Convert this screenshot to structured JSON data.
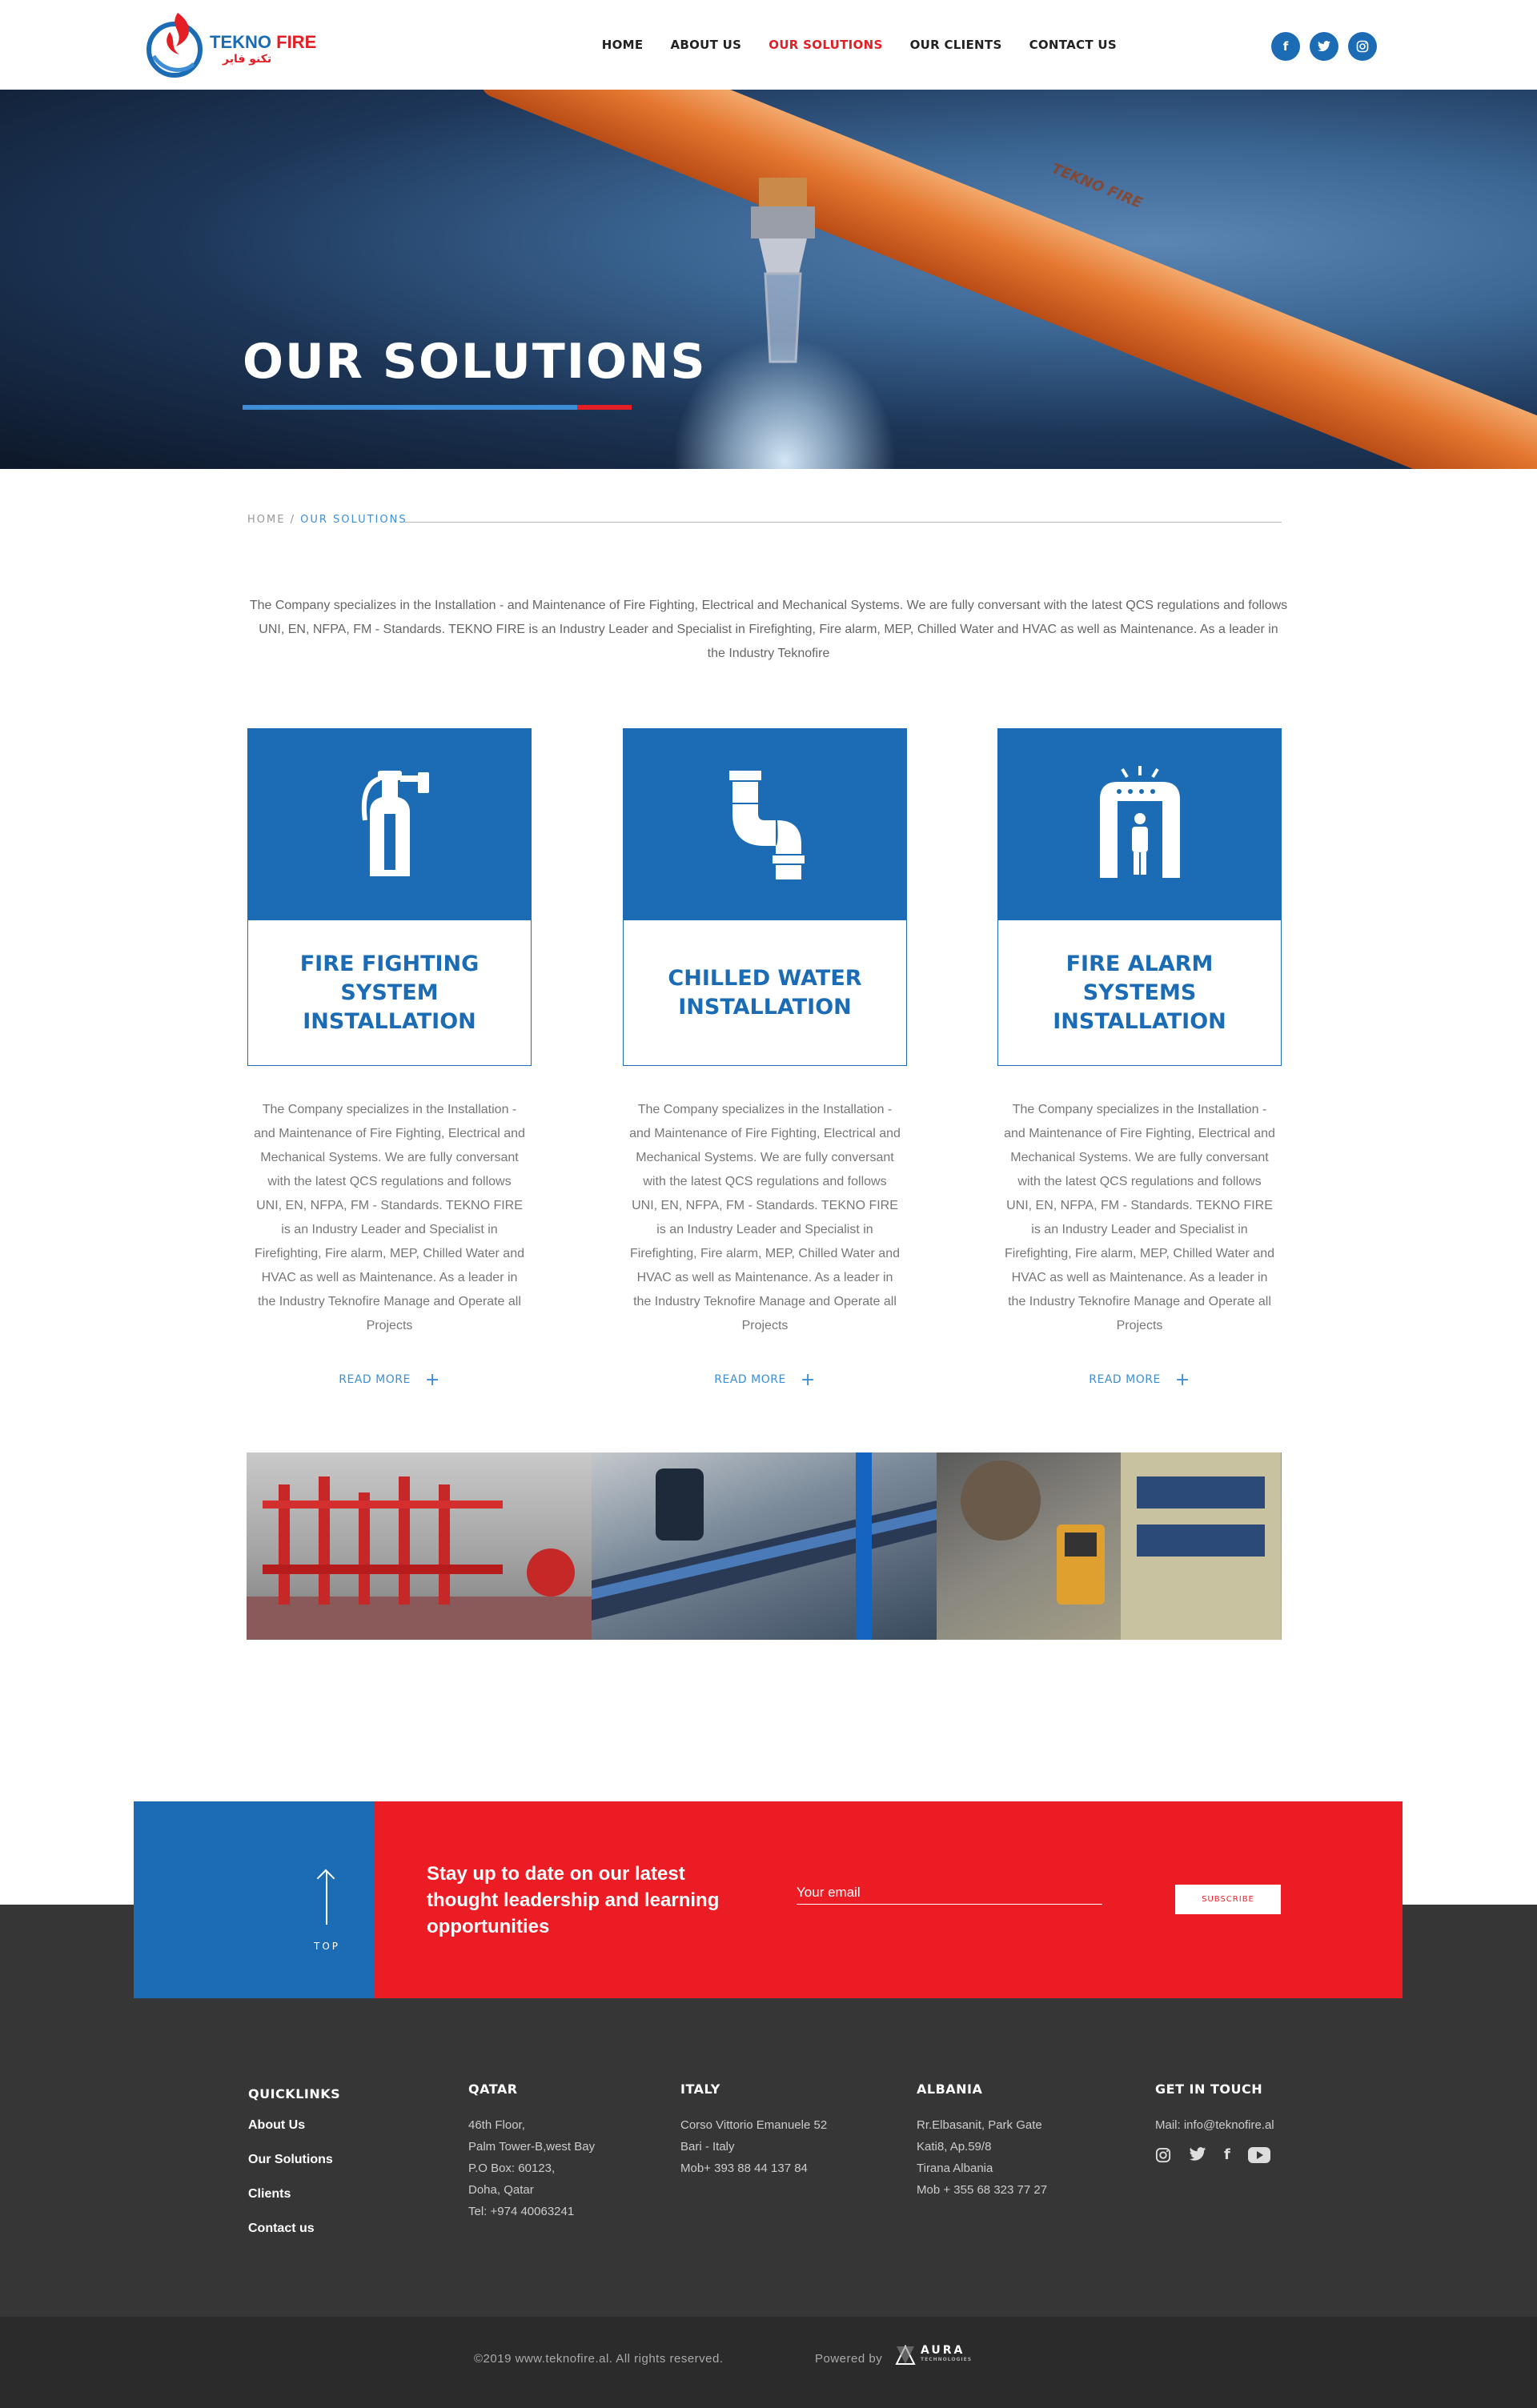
{
  "header": {
    "logo_title_a": "TEKNO",
    "logo_title_b": "FIRE",
    "logo_sub": "تكنو فاير",
    "nav": [
      "HOME",
      "ABOUT US",
      "OUR SOLUTIONS",
      "OUR CLIENTS",
      "CONTACT US"
    ],
    "active_nav": "OUR SOLUTIONS",
    "socials": [
      "facebook-icon",
      "twitter-icon",
      "instagram-icon"
    ]
  },
  "hero": {
    "title": "OUR SOLUTIONS",
    "pipe_brand": "TEKNO FIRE"
  },
  "breadcrumb": {
    "home": "HOME",
    "separator": " / ",
    "current": "OUR SOLUTIONS"
  },
  "intro": "The Company specializes in the Installation - and Maintenance of Fire Fighting, Electrical and Mechanical Systems. We are fully conversant with the latest QCS regulations and follows UNI, EN, NFPA, FM - Standards. TEKNO FIRE is an Industry Leader and Specialist in Firefighting, Fire alarm, MEP, Chilled Water and HVAC as well as Maintenance. As a leader in the Industry Teknofire",
  "cards": [
    {
      "icon": "fire-extinguisher-icon",
      "title": "FIRE FIGHTING SYSTEM INSTALLATION",
      "text": "The Company specializes in the Installation - and Maintenance of Fire Fighting, Electrical and Mechanical Systems. We are fully conversant with the latest QCS regulations and follows UNI, EN, NFPA, FM - Standards. TEKNO FIRE is an Industry Leader and Specialist in Firefighting, Fire alarm, MEP, Chilled Water and HVAC as well as Maintenance. As a leader in the Industry Teknofire Manage and Operate all Projects",
      "read_more": "READ MORE"
    },
    {
      "icon": "pipe-icon",
      "title": "CHILLED WATER INSTALLATION",
      "text": "The Company specializes in the Installation - and Maintenance of Fire Fighting, Electrical and Mechanical Systems. We are fully conversant with the latest QCS regulations and follows UNI, EN, NFPA, FM - Standards. TEKNO FIRE is an Industry Leader and Specialist in Firefighting, Fire alarm, MEP, Chilled Water and HVAC as well as Maintenance. As a leader in the Industry Teknofire Manage and Operate all Projects",
      "read_more": "READ MORE"
    },
    {
      "icon": "alarm-gate-icon",
      "title": "FIRE ALARM SYSTEMS INSTALLATION",
      "text": "The Company specializes in the Installation - and Maintenance of Fire Fighting, Electrical and Mechanical Systems. We are fully conversant with the latest QCS regulations and follows UNI, EN, NFPA, FM - Standards. TEKNO FIRE is an Industry Leader and Specialist in Firefighting, Fire alarm, MEP, Chilled Water and HVAC as well as Maintenance. As a leader in the Industry Teknofire Manage and Operate all Projects",
      "read_more": "READ MORE"
    }
  ],
  "gallery": [
    "fire-pipes-photo",
    "chilled-water-pipe-photo",
    "electrical-panel-photo"
  ],
  "newsletter": {
    "top_label": "TOP",
    "heading": "Stay up to date on our latest thought leadership and learning opportunities",
    "email_placeholder": "Your email",
    "subscribe": "SUBSCRIBE"
  },
  "footer": {
    "quicklinks": {
      "title": "QUICKLINKS",
      "links": [
        "About Us",
        "Our Solutions",
        "Clients",
        "Contact us"
      ]
    },
    "qatar": {
      "title": "QATAR",
      "lines": [
        "46th Floor,",
        "Palm Tower-B,west Bay",
        "P.O Box: 60123,",
        "Doha, Qatar",
        "Tel: +974 40063241"
      ]
    },
    "italy": {
      "title": "ITALY",
      "lines": [
        "Corso Vittorio Emanuele 52",
        "Bari - Italy",
        "Mob+ 393 88 44 137 84"
      ]
    },
    "albania": {
      "title": "ALBANIA",
      "lines": [
        "Rr.Elbasanit, Park Gate",
        "Kati8, Ap.59/8",
        "Tirana Albania",
        "Mob + 355 68 323 77 27"
      ]
    },
    "contact": {
      "title": "GET IN TOUCH",
      "mail": "Mail: info@teknofire.al",
      "icons": [
        "instagram-icon",
        "twitter-icon",
        "facebook-icon",
        "youtube-icon"
      ]
    },
    "copyright": "©2019 www.teknofire.al. All rights reserved.",
    "powered_by": "Powered by",
    "powered_brand": "AURA",
    "powered_brand_sub": "TECHNOLOGIES"
  },
  "colors": {
    "brand_blue": "#1b6cb5",
    "brand_red": "#ec1c24",
    "footer_bg": "#363636"
  }
}
